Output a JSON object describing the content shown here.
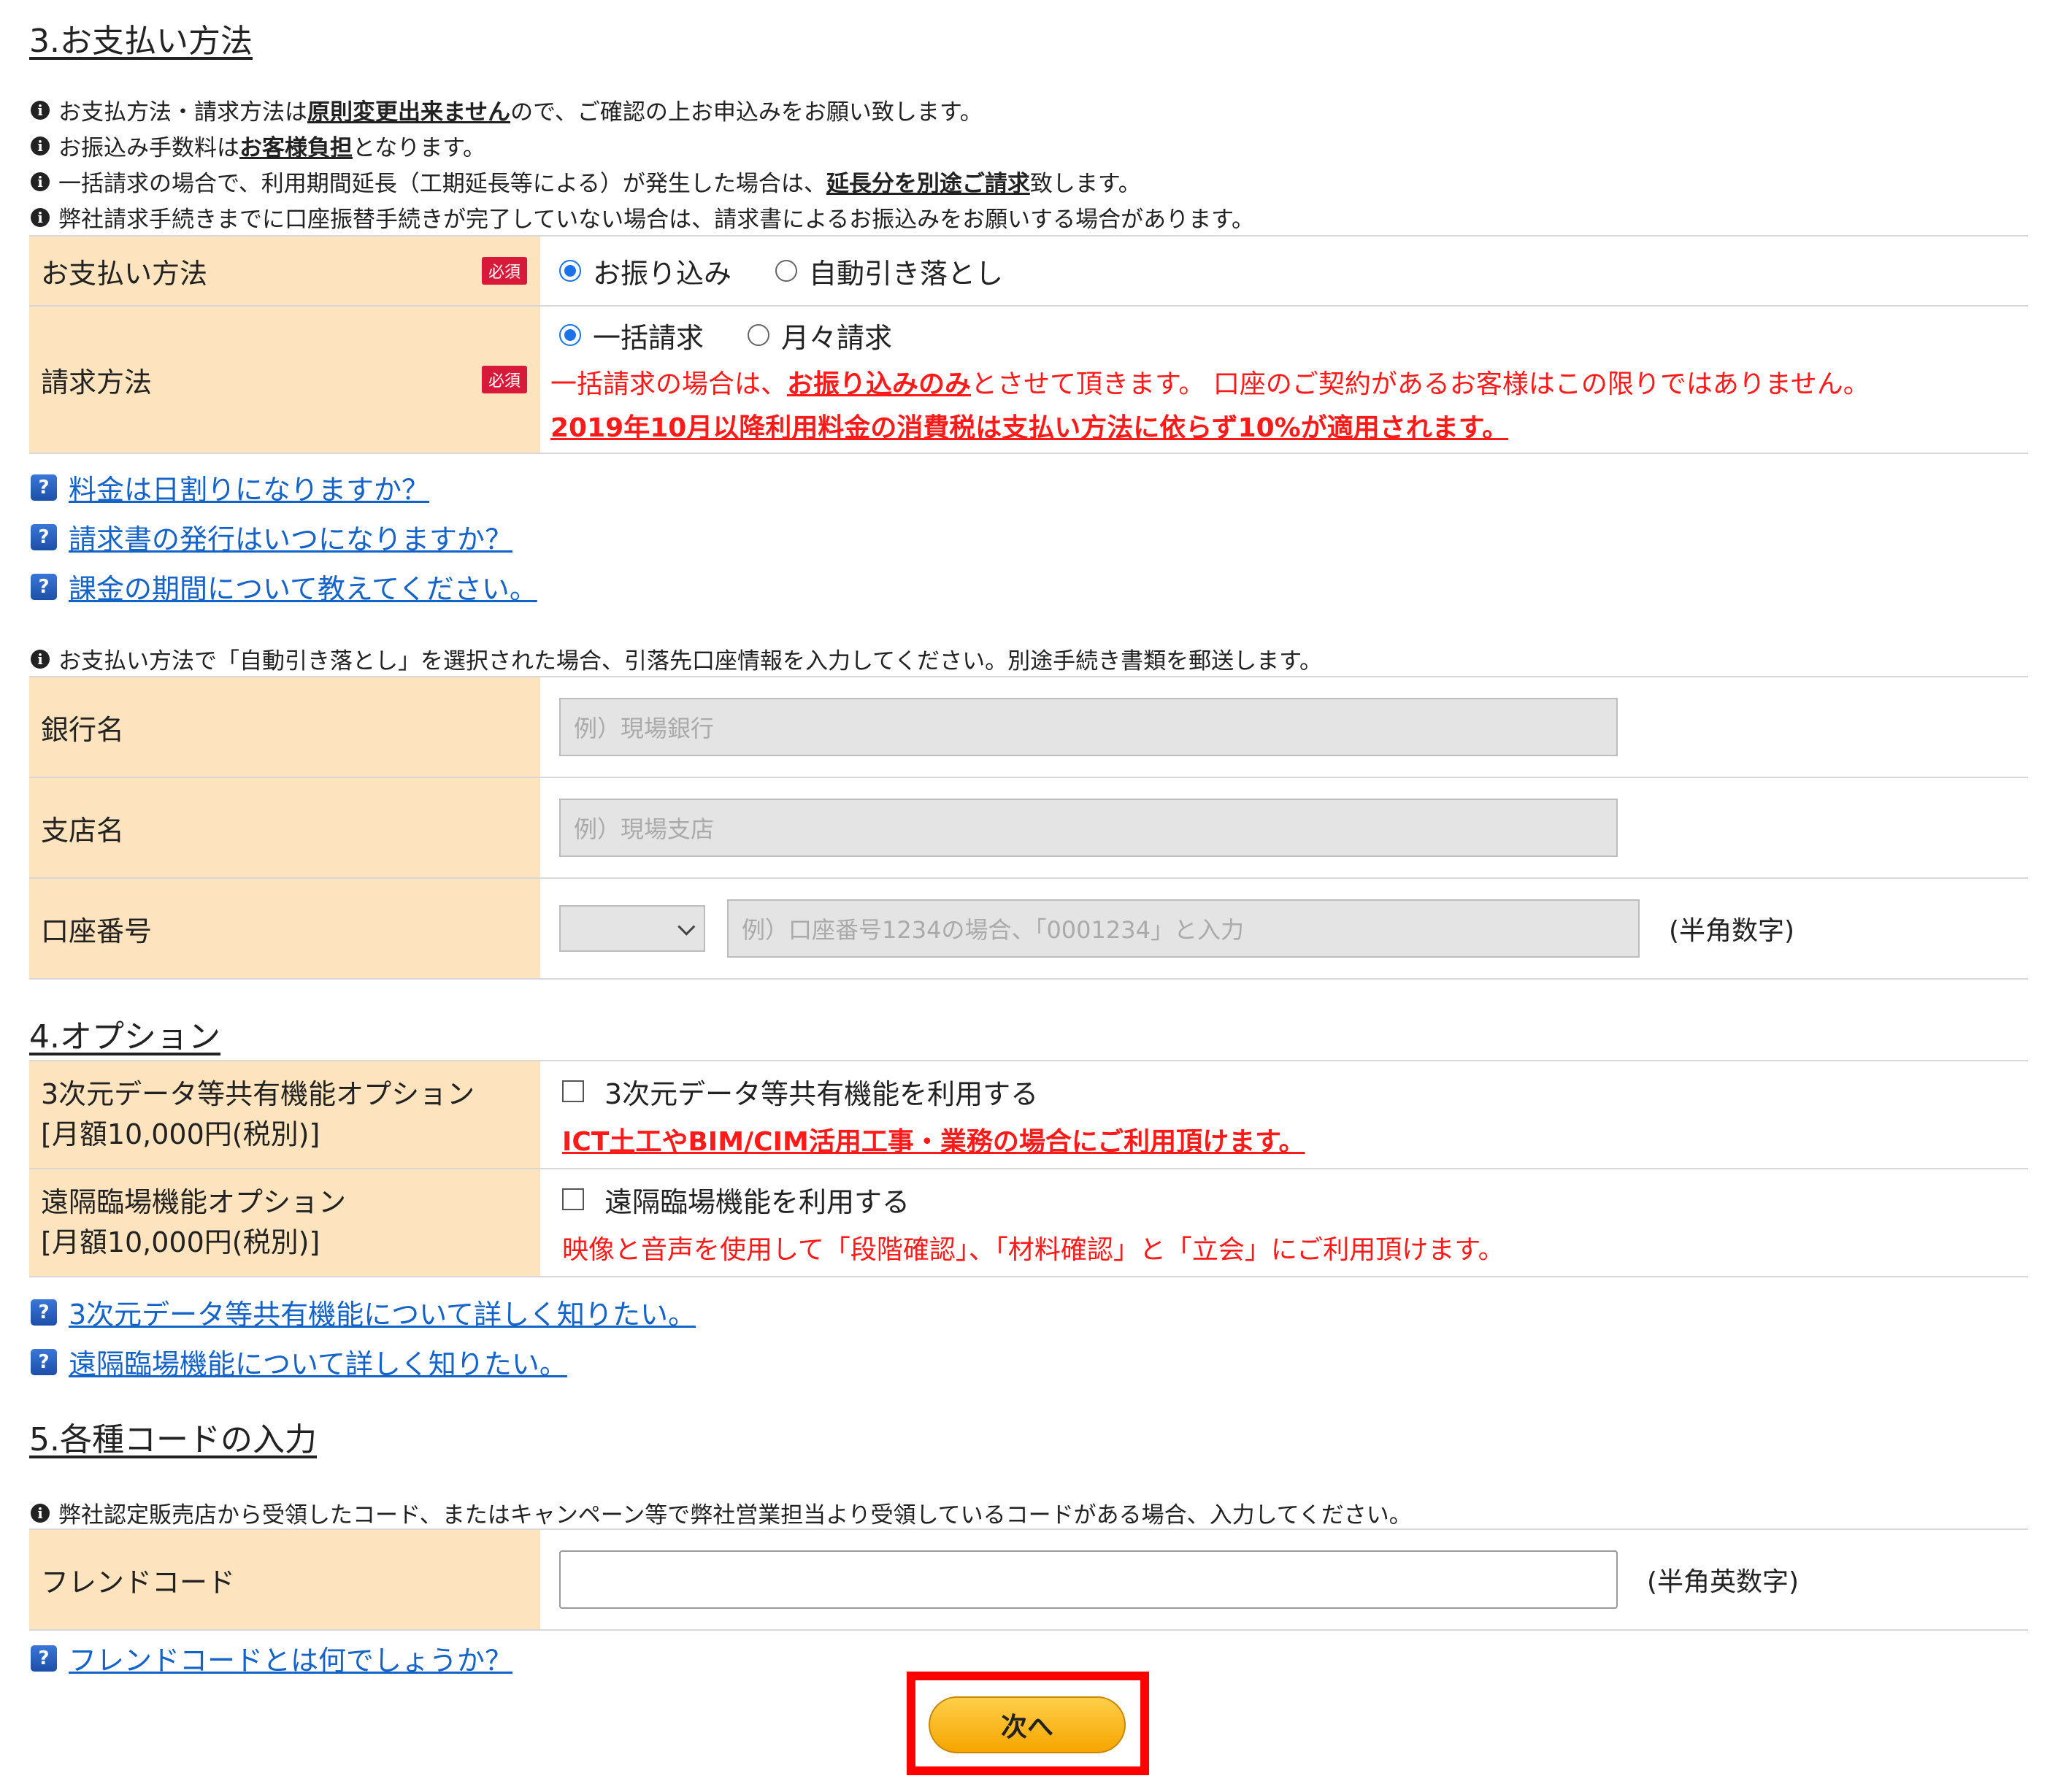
{
  "sections": {
    "payment_title": "3.お支払い方法",
    "option_title": "4.オプション",
    "code_title": "5.各種コードの入力"
  },
  "payment_notes": {
    "n1_a": "お支払方法・請求方法は",
    "n1_b": "原則変更出来ません",
    "n1_c": "ので、ご確認の上お申込みをお願い致します。",
    "n2_a": "お振込み手数料は",
    "n2_b": "お客様負担",
    "n2_c": "となります。",
    "n3_a": "一括請求の場合で、利用期間延長（工期延長等による）が発生した場合は、",
    "n3_b": "延長分を別途ご請求",
    "n3_c": "致します。",
    "n4": "弊社請求手続きまでに口座振替手続きが完了していない場合は、請求書によるお振込みをお願いする場合があります。"
  },
  "required_badge": "必須",
  "payment_method": {
    "label": "お支払い方法",
    "options": [
      "お振り込み",
      "自動引き落とし"
    ],
    "selected": "お振り込み"
  },
  "billing_method": {
    "label": "請求方法",
    "options": [
      "一括請求",
      "月々請求"
    ],
    "selected": "一括請求",
    "note_a": "一括請求の場合は、",
    "note_b": "お振り込みのみ",
    "note_c": "とさせて頂きます。 口座のご契約があるお客様はこの限りではありません。",
    "tax_note": "2019年10月以降利用料金の消費税は支払い方法に依らず10%が適用されます。"
  },
  "faq_payment": [
    "料金は日割りになりますか？",
    "請求書の発行はいつになりますか？",
    "課金の期間について教えてください。"
  ],
  "bank_note": "お支払い方法で「自動引き落とし」を選択された場合、引落先口座情報を入力してください。別途手続き書類を郵送します。",
  "bank": {
    "bank_label": "銀行名",
    "bank_placeholder": "例）現場銀行",
    "branch_label": "支店名",
    "branch_placeholder": "例）現場支店",
    "account_label": "口座番号",
    "account_placeholder": "例）口座番号1234の場合、「0001234」と入力",
    "account_suffix": "(半角数字)"
  },
  "options": {
    "opt1_label_1": "3次元データ等共有機能オプション",
    "opt1_label_2": "[月額10,000円(税別)]",
    "opt1_check": "3次元データ等共有機能を利用する",
    "opt1_note": "ICT土工やBIM/CIM活用工事・業務の場合にご利用頂けます。",
    "opt2_label_1": "遠隔臨場機能オプション",
    "opt2_label_2": "[月額10,000円(税別)]",
    "opt2_check": "遠隔臨場機能を利用する",
    "opt2_note": "映像と音声を使用して「段階確認」、「材料確認」と「立会」にご利用頂けます。"
  },
  "faq_options": [
    "3次元データ等共有機能について詳しく知りたい。",
    "遠隔臨場機能について詳しく知りたい。"
  ],
  "code_note": "弊社認定販売店から受領したコード、またはキャンペーン等で弊社営業担当より受領しているコードがある場合、入力してください。",
  "friend_code": {
    "label": "フレンドコード",
    "value": "",
    "suffix": "(半角英数字)",
    "faq": "フレンドコードとは何でしょうか？"
  },
  "next_button": "次へ",
  "colors": {
    "label_bg": "#fde4be",
    "required": "#d71a3a",
    "warning": "#ff1a1a",
    "link": "#1463c8",
    "radio_selected": "#1a73e8",
    "button": "#f5a500",
    "highlight": "#ff0000"
  }
}
